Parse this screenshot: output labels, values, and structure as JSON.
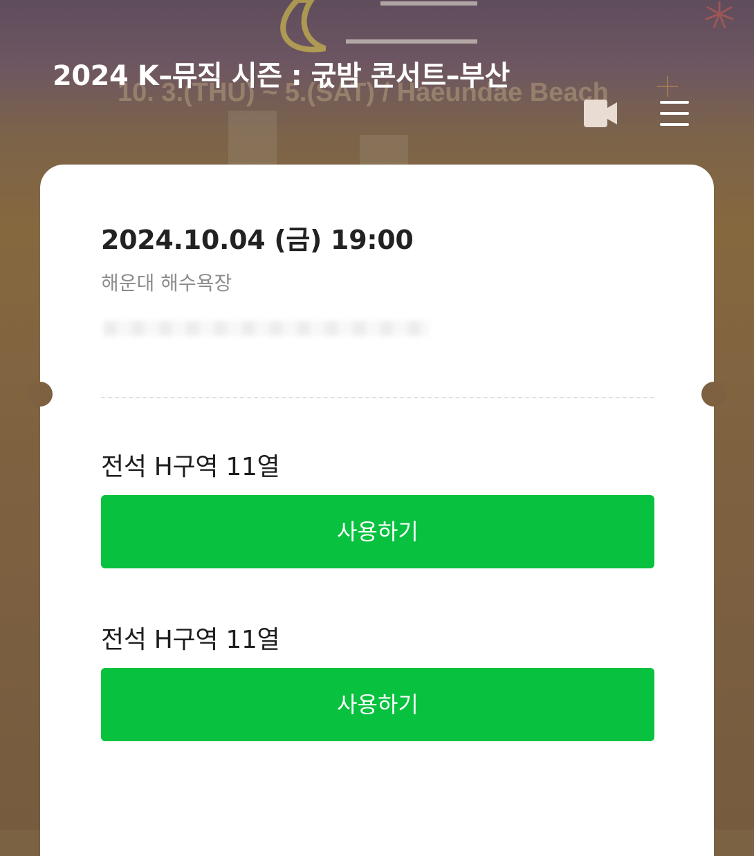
{
  "header": {
    "title": "2024 K–뮤직 시즌 : 굯밤 콘서트–부산",
    "video_icon": "video-camera-icon",
    "menu_icon": "hamburger-menu-icon"
  },
  "poster": {
    "banner_text": "10. 3.(THU) ~ 5.(SAT) / Haeundae Beach"
  },
  "ticket": {
    "datetime": "2024.10.04 (금) 19:00",
    "venue": "해운대 해수욕장",
    "seats": [
      {
        "label": "전석 H구역 11열",
        "button": "사용하기"
      },
      {
        "label": "전석 H구역 11열",
        "button": "사용하기"
      }
    ]
  },
  "colors": {
    "accent_green": "#08c13f",
    "background_brown": "#7d6140",
    "card_white": "#ffffff"
  }
}
